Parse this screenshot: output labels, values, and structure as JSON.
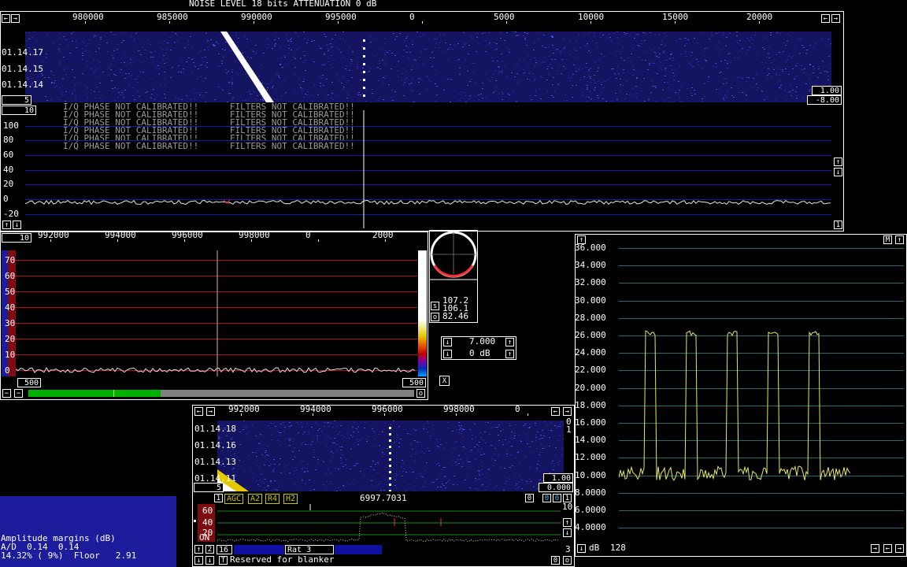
{
  "header": {
    "title": "NOISE LEVEL 18 bits ATTENUATION 0 dB"
  },
  "wide": {
    "ticks": [
      "980000",
      "985000",
      "990000",
      "995000",
      "0",
      "5000",
      "10000",
      "15000",
      "20000"
    ],
    "timestamps": [
      "01.14.17",
      "01.14.15",
      "01.14.14"
    ],
    "avg_box": "5",
    "gain_box": "1.00",
    "offset_box": "-8.00",
    "spectrum_box": "10",
    "warn_lines": [
      "I/Q PHASE NOT CALIBRATED!!      FILTERS NOT CALIBRATED!!",
      "I/Q PHASE NOT CALIBRATED!!      FILTERS NOT CALIBRATED!!",
      "I/Q PHASE NOT CALIBRATED!!      FILTERS NOT CALIBRATED!!",
      "I/Q PHASE NOT CALIBRATED!!      FILTERS NOT CALIBRATED!!",
      "I/Q PHASE NOT CALIBRATED!!      FILTERS NOT CALIBRATED!!",
      "I/Q PHASE NOT CALIBRATED!!      FILTERS NOT CALIBRATED!!"
    ],
    "y_labels": [
      "100",
      "80",
      "60",
      "40",
      "20",
      "0",
      "-20"
    ],
    "right_small": "1"
  },
  "baseband": {
    "box_left": "10",
    "ticks": [
      "992000",
      "994000",
      "996000",
      "998000",
      "0",
      "2000"
    ],
    "y_labels": [
      "70",
      "60",
      "50",
      "40",
      "30",
      "20",
      "10",
      "0"
    ],
    "bw_left": "500",
    "bw_right": "500",
    "o_label": "o"
  },
  "smeter": {
    "s_label": "s",
    "o_label": "o",
    "v1": "107.2",
    "v2": "106.1",
    "v3": "82.46"
  },
  "freqctrl": {
    "freq": "7.000",
    "db": "0 dB",
    "x": "X"
  },
  "hires": {
    "ticks": [
      "992000",
      "994000",
      "996000",
      "998000",
      "0"
    ],
    "timestamps": [
      "01.14.18",
      "01.14.16",
      "01.14.13",
      "01.14.11"
    ],
    "right_top": "0",
    "right_mid": "1",
    "gain_box": "1.00",
    "offset_box": "0.000",
    "avg_box": "5",
    "ctrl_1": "1",
    "agc": "AGC",
    "a2": "A2",
    "r4": "R4",
    "h2": "H2",
    "freq_readout": "6997.7031",
    "b0": "0",
    "b0b": "0",
    "b0c": "0",
    "b1": "1",
    "y_labels": [
      "60",
      "40",
      "20"
    ],
    "on_label": "ON",
    "right_10": "10",
    "right_3": "3",
    "bottom_16": "16",
    "bottom_rat": "Rat  3",
    "bottom_2": "2",
    "bottom_reserved": "Reserved for blanker",
    "bottom_o": "o",
    "bottom_0": "0"
  },
  "amplitude": {
    "title": "Amplitude margins (dB)",
    "ad": "A/D  0.14  0.14",
    "pct": "14.32% ( 9%)  Floor   2.91"
  },
  "graph": {
    "y_labels": [
      "36.000",
      "34.000",
      "32.000",
      "30.000",
      "28.000",
      "26.000",
      "24.000",
      "22.000",
      "20.000",
      "18.000",
      "16.000",
      "14.000",
      "12.000",
      "10.000",
      "8.0000",
      "6.0000",
      "4.0000"
    ],
    "m_label": "M",
    "db_label": "dB",
    "db_value": "128"
  }
}
